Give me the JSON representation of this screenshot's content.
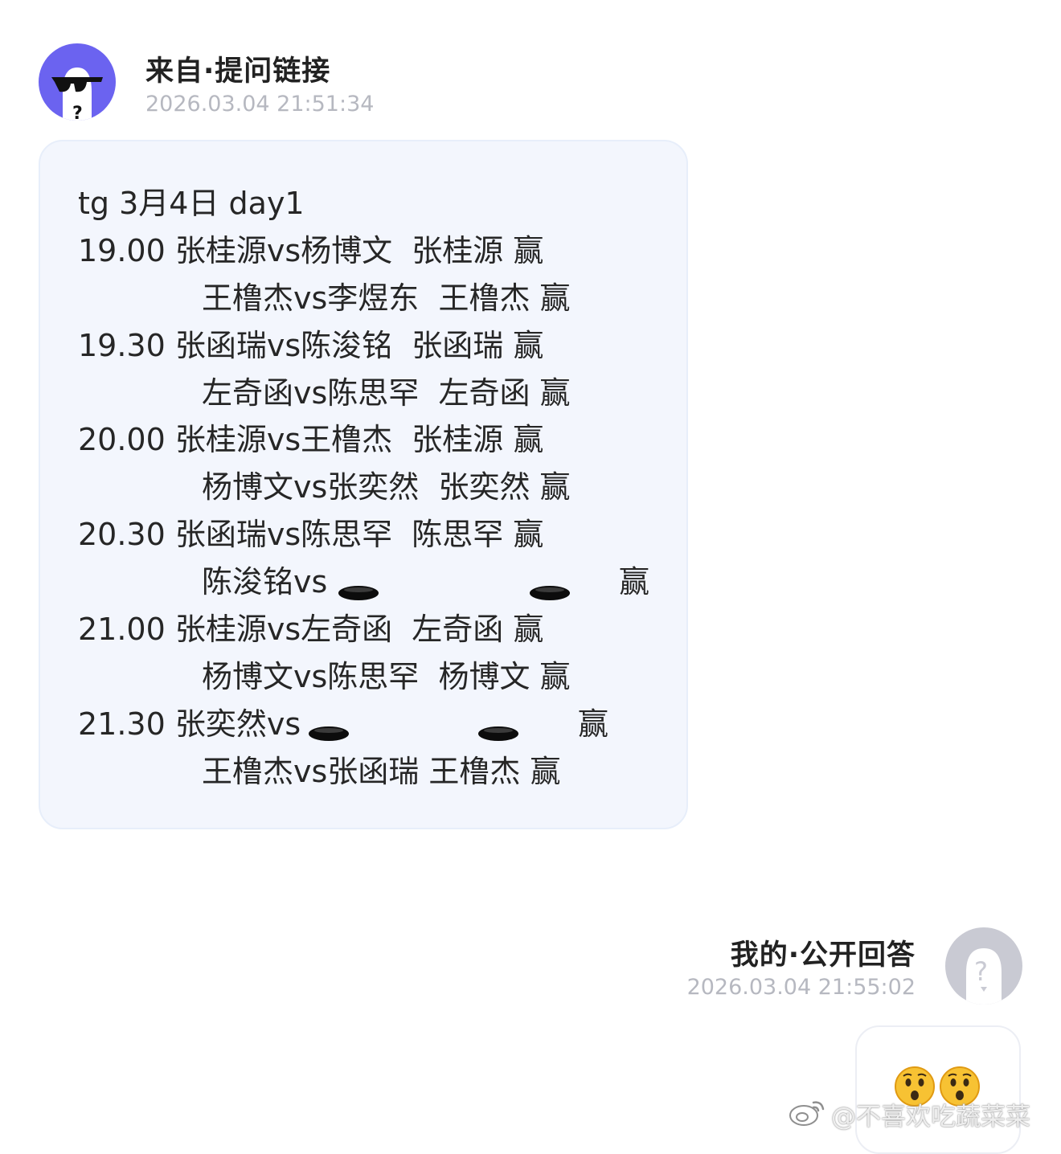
{
  "incoming": {
    "sender": "来自·提问链接",
    "time": "2026.03.04 21:51:34",
    "avatar_icon": "sunglasses-ghost-icon",
    "avatar_color": "#6b63f0",
    "lines": [
      "tg 3月4日 day1",
      "19.00 张桂源vs杨博文  张桂源 赢",
      "王橹杰vs李煜东  王橹杰 赢",
      "19.30 张函瑞vs陈浚铭  张函瑞 赢",
      "左奇函vs陈思罕  左奇函 赢",
      "20.00 张桂源vs王橹杰  张桂源 赢",
      "杨博文vs张奕然  张奕然 赢",
      "20.30 张函瑞vs陈思罕  陈思罕 赢",
      "陈浚铭vs",
      "赢",
      "21.00 张桂源vs左奇函  左奇函 赢",
      "杨博文vs陈思罕  杨博文 赢",
      "21.30 张奕然vs",
      "赢",
      "王橹杰vs张函瑞 王橹杰 赢"
    ],
    "hole_icon": "hole-emoji-icon"
  },
  "reply": {
    "title": "我的·公开回答",
    "time": "2026.03.04 21:55:02",
    "avatar_icon": "question-avatar-icon",
    "emojis": [
      "astonished-face-icon",
      "astonished-face-icon"
    ]
  },
  "watermark": {
    "logo_icon": "weibo-logo-icon",
    "text": "@不喜欢吃蔬菜菜"
  }
}
